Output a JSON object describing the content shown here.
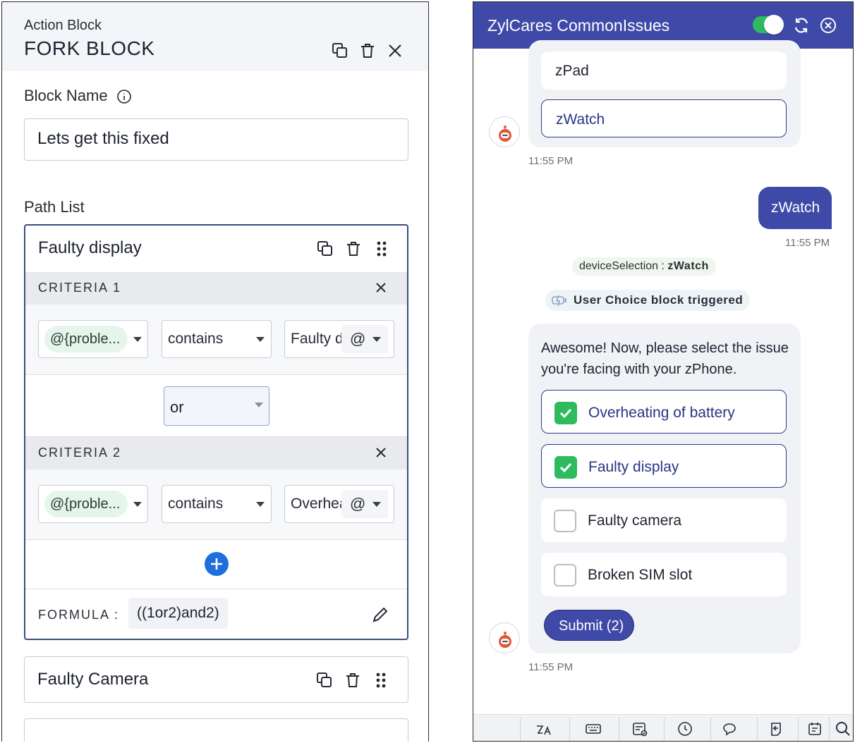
{
  "left_panel": {
    "subtitle": "Action Block",
    "title": "FORK BLOCK",
    "block_name_label": "Block Name",
    "block_name_value": "Lets get this fixed",
    "path_list_label": "Path List",
    "paths": [
      {
        "title": "Faulty display",
        "criteria": [
          {
            "label": "CRITERIA 1",
            "variable": "@{proble...",
            "operator": "contains",
            "value": "Faulty d"
          },
          {
            "label": "CRITERIA 2",
            "variable": "@{proble...",
            "operator": "contains",
            "value": "Overhea"
          }
        ],
        "joiner": "or",
        "formula_label": "FORMULA :",
        "formula_value": "((1or2)and2)"
      },
      {
        "title": "Faulty Camera"
      }
    ],
    "at_symbol": "@"
  },
  "chat": {
    "title": "ZylCares CommonIssues",
    "toggle_on": true,
    "device_options": [
      "zPad",
      "zWatch"
    ],
    "time1": "11:55 PM",
    "user_message": "zWatch",
    "time2": "11:55 PM",
    "variable_pill_key": "deviceSelection : ",
    "variable_pill_value": "zWatch",
    "trigger_text": "User Choice block triggered",
    "prompt": "Awesome! Now, please select the issue you're facing with your zPhone.",
    "issues": [
      {
        "label": "Overheating of battery",
        "checked": true
      },
      {
        "label": "Faulty display",
        "checked": true
      },
      {
        "label": "Faulty camera",
        "checked": false
      },
      {
        "label": "Broken SIM slot",
        "checked": false
      }
    ],
    "submit_label": "Submit (2)",
    "time3": "11:55 PM"
  },
  "colors": {
    "brand": "#3f4aa8",
    "success": "#2dbb5d",
    "add": "#1e6fdc"
  },
  "icons": [
    "copy-icon",
    "trash-icon",
    "close-icon",
    "info-icon",
    "drag-handle-icon",
    "plus-icon",
    "pencil-icon",
    "refresh-icon",
    "close-circle-icon",
    "bot-avatar-icon",
    "check-icon",
    "translate-icon",
    "keyboard-icon",
    "form-icon",
    "clock-icon",
    "chat-icon",
    "back-icon",
    "notes-icon",
    "search-icon"
  ]
}
